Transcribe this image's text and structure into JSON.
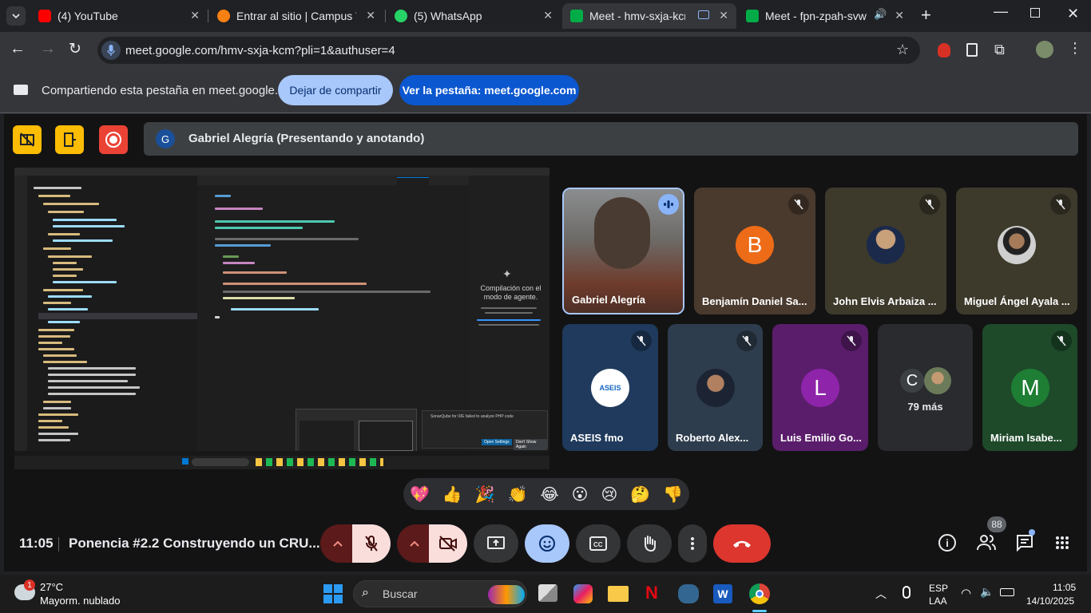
{
  "tabs": [
    {
      "title": "(4) YouTube",
      "icon": "youtube-icon",
      "color": "#ff0000"
    },
    {
      "title": "Entrar al sitio | Campus Virtu",
      "icon": "moodle-icon",
      "color": "#f98012"
    },
    {
      "title": "(5) WhatsApp",
      "icon": "whatsapp-icon",
      "color": "#25d366"
    },
    {
      "title": "Meet - hmv-sxja-kcm",
      "icon": "meet-icon",
      "color": "#00ac47"
    },
    {
      "title": "Meet - fpn-zpah-svw",
      "icon": "meet-icon",
      "color": "#00ac47"
    }
  ],
  "url": "meet.google.com/hmv-sxja-kcm?pli=1&authuser=4",
  "share_bar": {
    "message": "Compartiendo esta pestaña en meet.google.com",
    "stop_label": "Dejar de compartir",
    "view_label": "Ver la pestaña: meet.google.com"
  },
  "presenter": {
    "initial": "G",
    "label": "Gabriel Alegría (Presentando y anotando)"
  },
  "shared_screen": {
    "agent_title": "Compilación con el modo de agente.",
    "tooltip": "SonarQube for IDE failed to analyze PHP code",
    "open_settings": "Open Settings",
    "dont_show": "Don't Show Again"
  },
  "participants": [
    {
      "name": "Gabriel Alegría",
      "type": "video",
      "speaking": true
    },
    {
      "name": "Benjamín Daniel Sa...",
      "initial": "B",
      "bg": "#ee6c17",
      "muted": true
    },
    {
      "name": "John Elvis Arbaiza ...",
      "type": "photo",
      "muted": true
    },
    {
      "name": "Miguel Ángel Ayala ...",
      "type": "photo",
      "muted": true
    },
    {
      "name": "ASEIS fmo",
      "type": "logo",
      "muted": true
    },
    {
      "name": "Roberto Alex...",
      "type": "photo",
      "muted": true
    },
    {
      "name": "Luis Emilio Go...",
      "initial": "L",
      "bg": "#8e24aa",
      "muted": true
    },
    {
      "name": "79 más",
      "initial": "C"
    },
    {
      "name": "Miriam Isabe...",
      "initial": "M",
      "bg": "#1e7e34",
      "muted": true
    }
  ],
  "reactions": [
    "💖",
    "👍",
    "🎉",
    "👏",
    "😂",
    "😮",
    "😢",
    "🤔",
    "👎"
  ],
  "meeting": {
    "time": "11:05",
    "title": "Ponencia #2.2 Construyendo un CRU...",
    "people_count": "88"
  },
  "taskbar": {
    "weather_temp": "27°C",
    "weather_desc": "Mayorm. nublado",
    "weather_badge": "1",
    "search": "Buscar",
    "lang1": "ESP",
    "lang2": "LAA",
    "clock_time": "11:05",
    "clock_date": "14/10/2025"
  }
}
